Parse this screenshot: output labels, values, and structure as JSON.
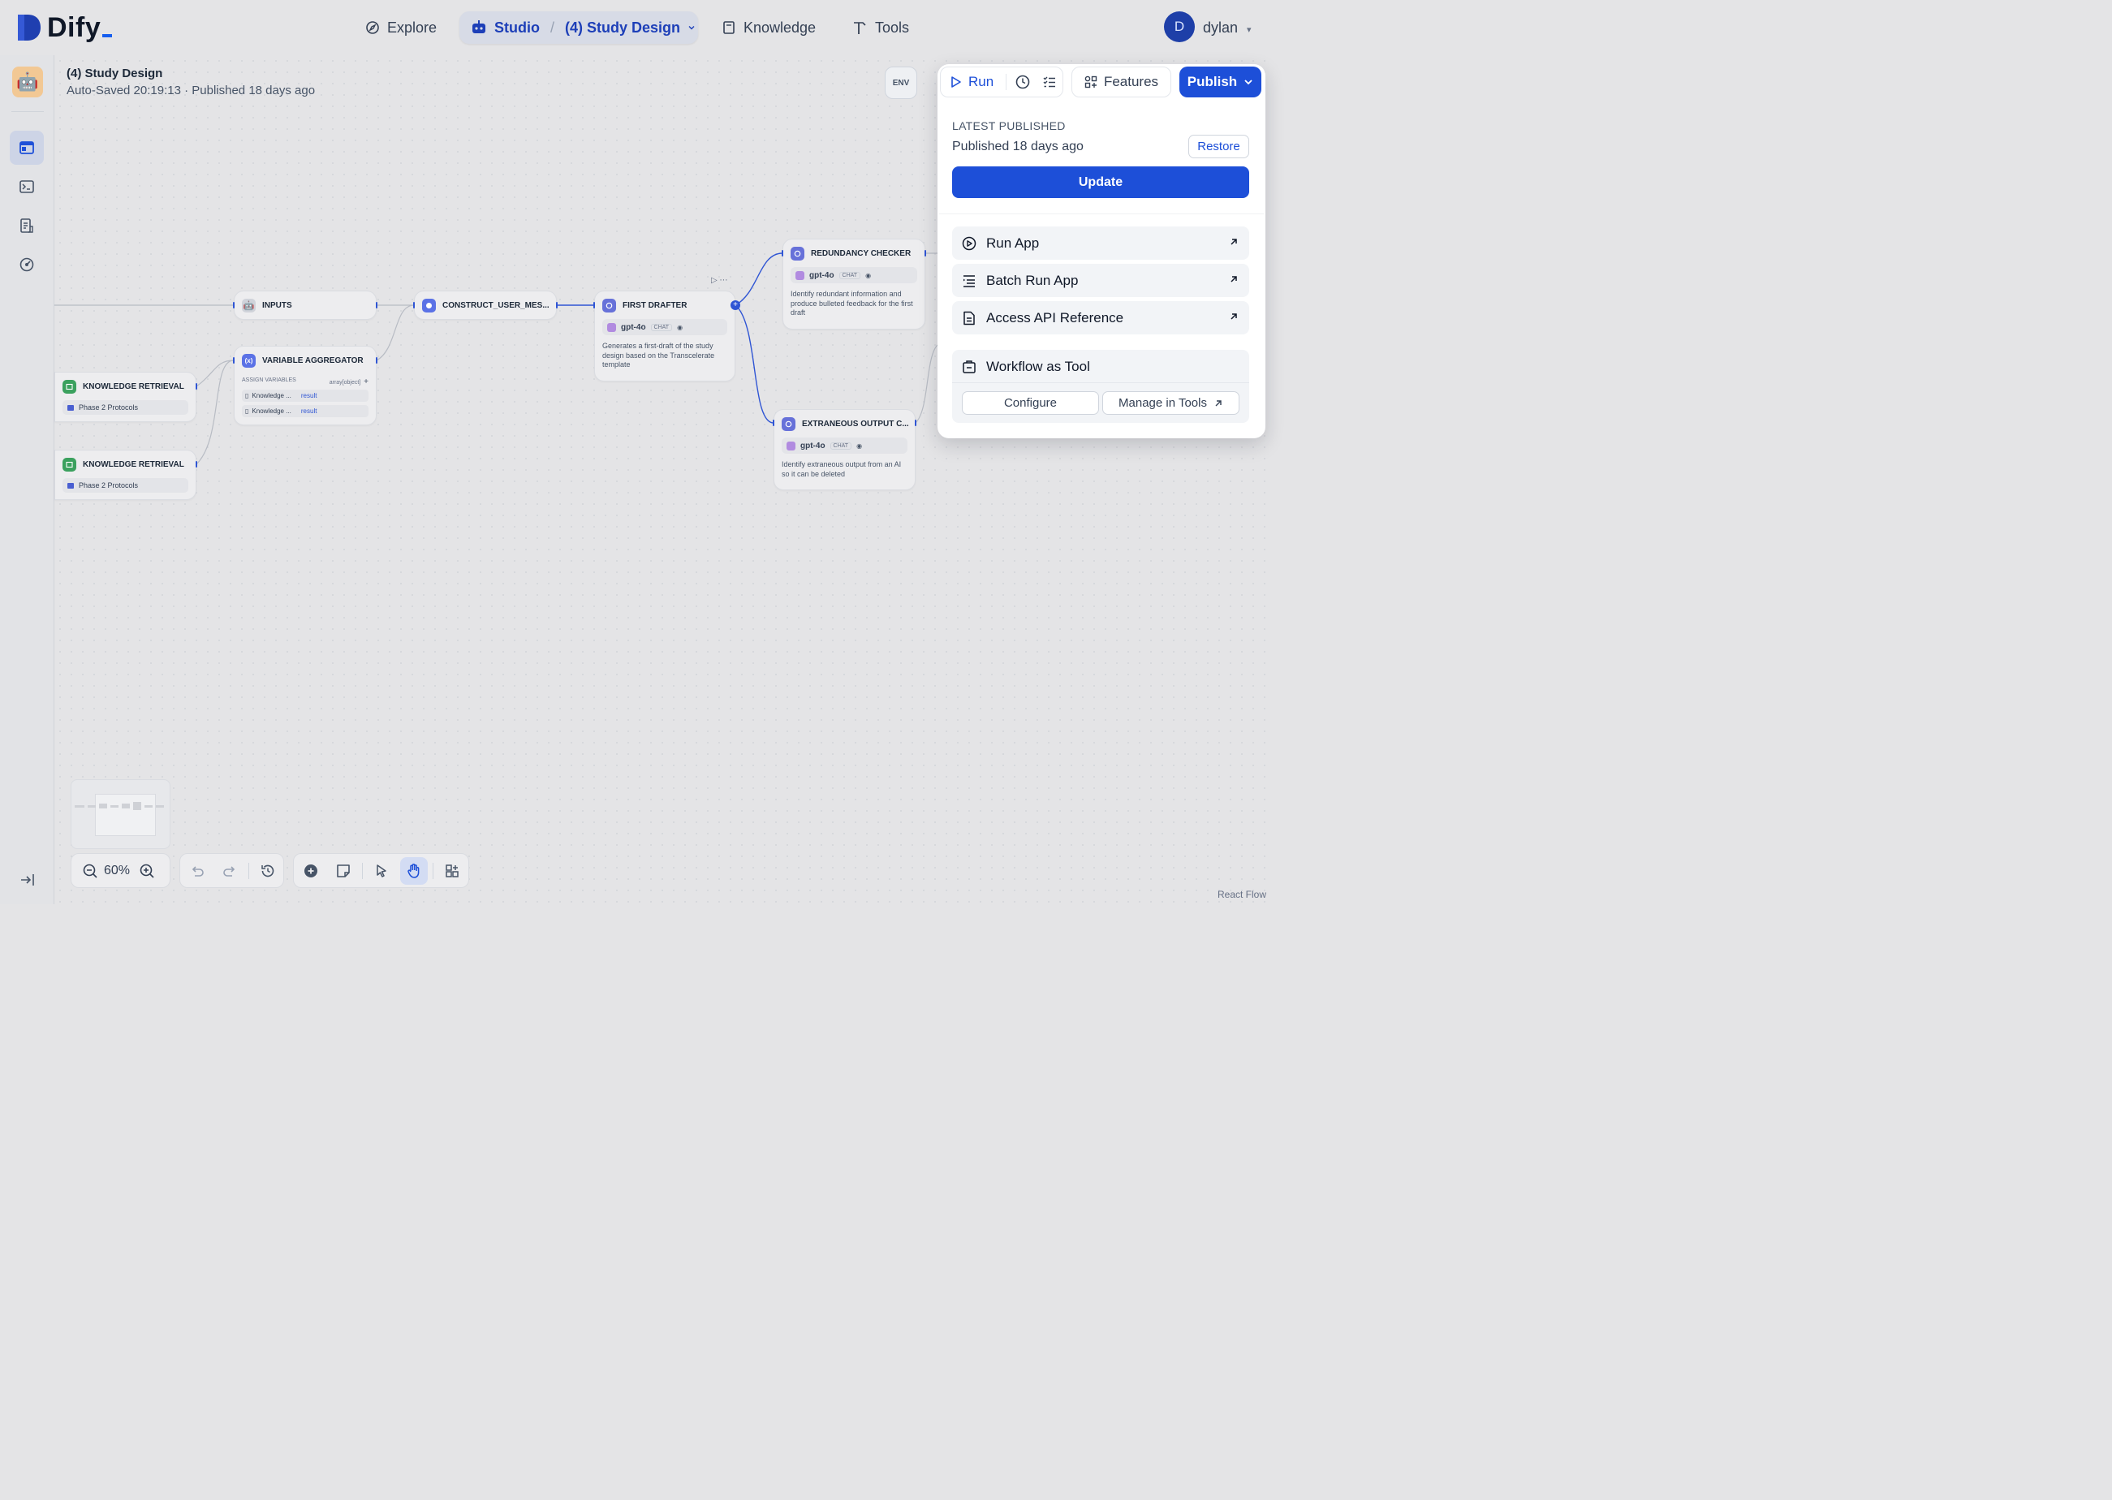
{
  "brand": {
    "name": "Dify"
  },
  "nav": {
    "explore": "Explore",
    "studio": "Studio",
    "app_name": "(4) Study Design",
    "knowledge": "Knowledge",
    "tools": "Tools"
  },
  "user": {
    "initial": "D",
    "name": "dylan"
  },
  "header": {
    "title": "(4) Study Design",
    "status": "Auto-Saved 20:19:13 · Published 18 days ago",
    "env": "ENV"
  },
  "toolbar": {
    "run": "Run",
    "features": "Features",
    "publish": "Publish"
  },
  "publish_panel": {
    "section_label": "LATEST PUBLISHED",
    "published": "Published 18 days ago",
    "restore": "Restore",
    "update": "Update",
    "menu": [
      {
        "label": "Run App",
        "icon": "play-circle-icon"
      },
      {
        "label": "Batch Run App",
        "icon": "list-icon"
      },
      {
        "label": "Access API Reference",
        "icon": "document-icon"
      }
    ],
    "workflow_tool": {
      "title": "Workflow as Tool",
      "configure": "Configure",
      "manage": "Manage in Tools"
    }
  },
  "nodes": {
    "inputs": {
      "title": "INPUTS"
    },
    "construct": {
      "title": "CONSTRUCT_USER_MES..."
    },
    "first_drafter": {
      "title": "FIRST DRAFTER",
      "model": "gpt-4o",
      "mode": "CHAT",
      "desc": "Generates a first-draft of the study design based on the Transcelerate template"
    },
    "redundancy": {
      "title": "REDUNDANCY CHECKER",
      "model": "gpt-4o",
      "mode": "CHAT",
      "desc": "Identify redundant information and produce bulleted feedback for the first draft"
    },
    "extraneous": {
      "title": "EXTRANEOUS OUTPUT C...",
      "model": "gpt-4o",
      "mode": "CHAT",
      "desc": "Identify extraneous output from an AI so it can be deleted"
    },
    "aggregator": {
      "title": "VARIABLE AGGREGATOR",
      "assign": "ASSIGN VARIABLES",
      "type": "array[object]",
      "plus": "+",
      "rows": [
        {
          "source": "Knowledge ...",
          "var": "result"
        },
        {
          "source": "Knowledge ...",
          "var": "result"
        }
      ]
    },
    "kr1": {
      "title": "KNOWLEDGE RETRIEVAL",
      "kb": "Phase 2 Protocols"
    },
    "kr2": {
      "title": "KNOWLEDGE RETRIEVAL",
      "kb": "Phase 2 Protocols"
    }
  },
  "controls": {
    "zoom": "60%"
  },
  "footer": {
    "attribution": "React Flow"
  },
  "colors": {
    "accent": "#1d4fd8",
    "background": "#e4e4e6"
  }
}
